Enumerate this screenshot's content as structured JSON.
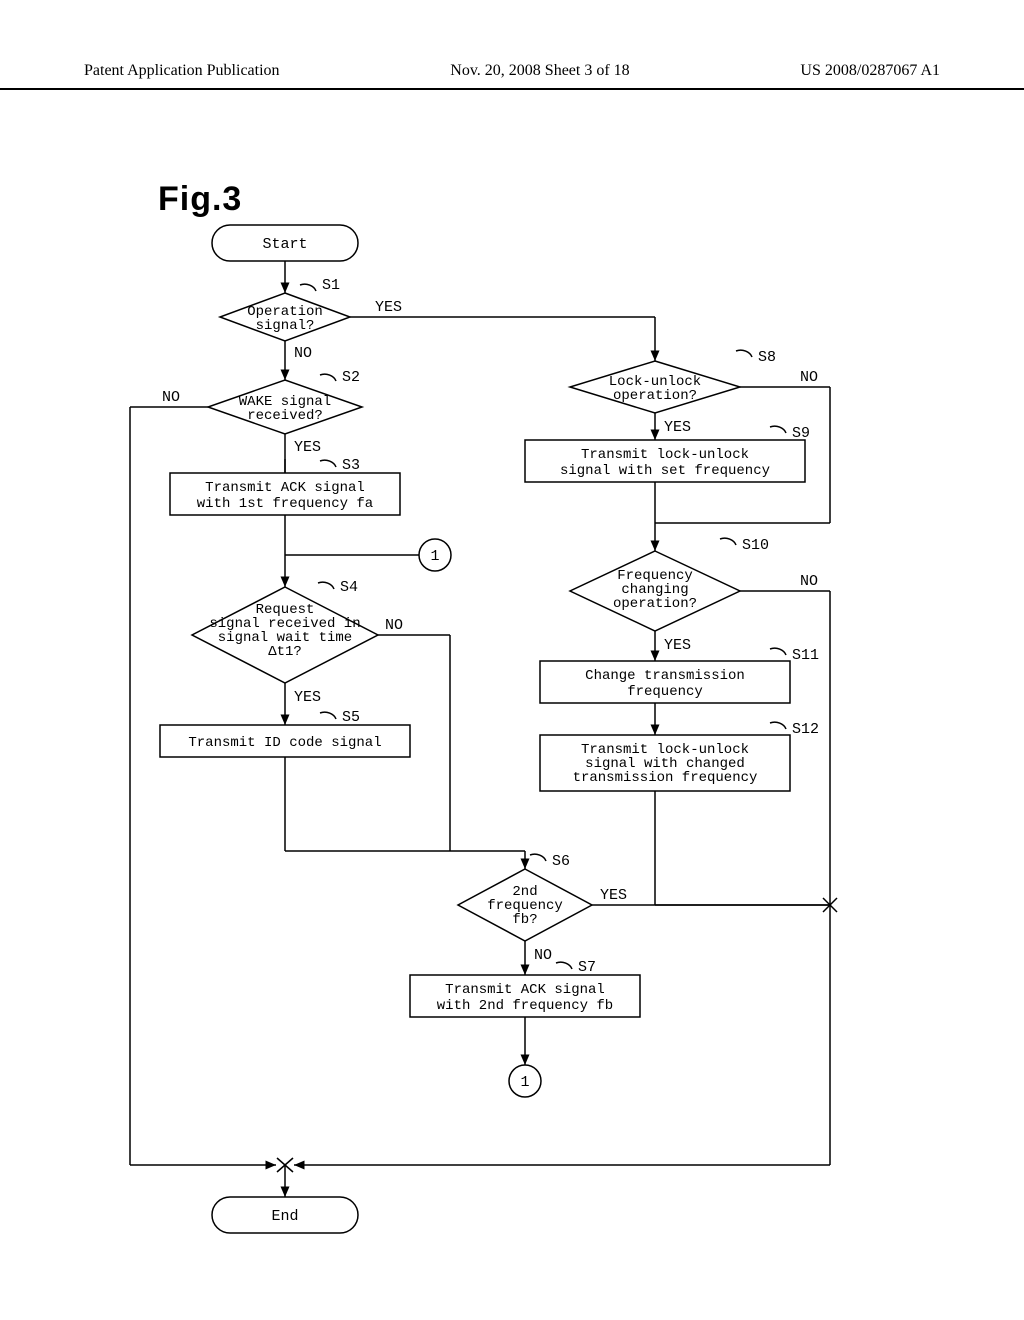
{
  "header": {
    "left": "Patent Application Publication",
    "center": "Nov. 20, 2008  Sheet 3 of 18",
    "right": "US 2008/0287067 A1"
  },
  "figure_title": "Fig.3",
  "flow": {
    "start": "Start",
    "end": "End",
    "s1": {
      "ref": "S1",
      "text": "Operation\nsignal?",
      "yes": "YES",
      "no": "NO"
    },
    "s2": {
      "ref": "S2",
      "text": "WAKE signal\nreceived?",
      "yes": "YES",
      "no": "NO"
    },
    "s3": {
      "ref": "S3",
      "text": "Transmit ACK signal\nwith 1st frequency fa"
    },
    "s4": {
      "ref": "S4",
      "text": "Request\nsignal received in\nsignal wait time\nΔt1?",
      "yes": "YES",
      "no": "NO"
    },
    "s5": {
      "ref": "S5",
      "text": "Transmit ID code signal"
    },
    "s6": {
      "ref": "S6",
      "text": "2nd\nfrequency\nfb?",
      "yes": "YES",
      "no": "NO"
    },
    "s7": {
      "ref": "S7",
      "text": "Transmit ACK signal\nwith 2nd frequency fb"
    },
    "s8": {
      "ref": "S8",
      "text": "Lock-unlock\noperation?",
      "yes": "YES",
      "no": "NO"
    },
    "s9": {
      "ref": "S9",
      "text": "Transmit lock-unlock\nsignal with set frequency"
    },
    "s10": {
      "ref": "S10",
      "text": "Frequency\nchanging\noperation?",
      "yes": "YES",
      "no": "NO"
    },
    "s11": {
      "ref": "S11",
      "text": "Change transmission\nfrequency"
    },
    "s12": {
      "ref": "S12",
      "text": "Transmit lock-unlock\nsignal with changed\ntransmission frequency"
    },
    "connector": "1"
  }
}
